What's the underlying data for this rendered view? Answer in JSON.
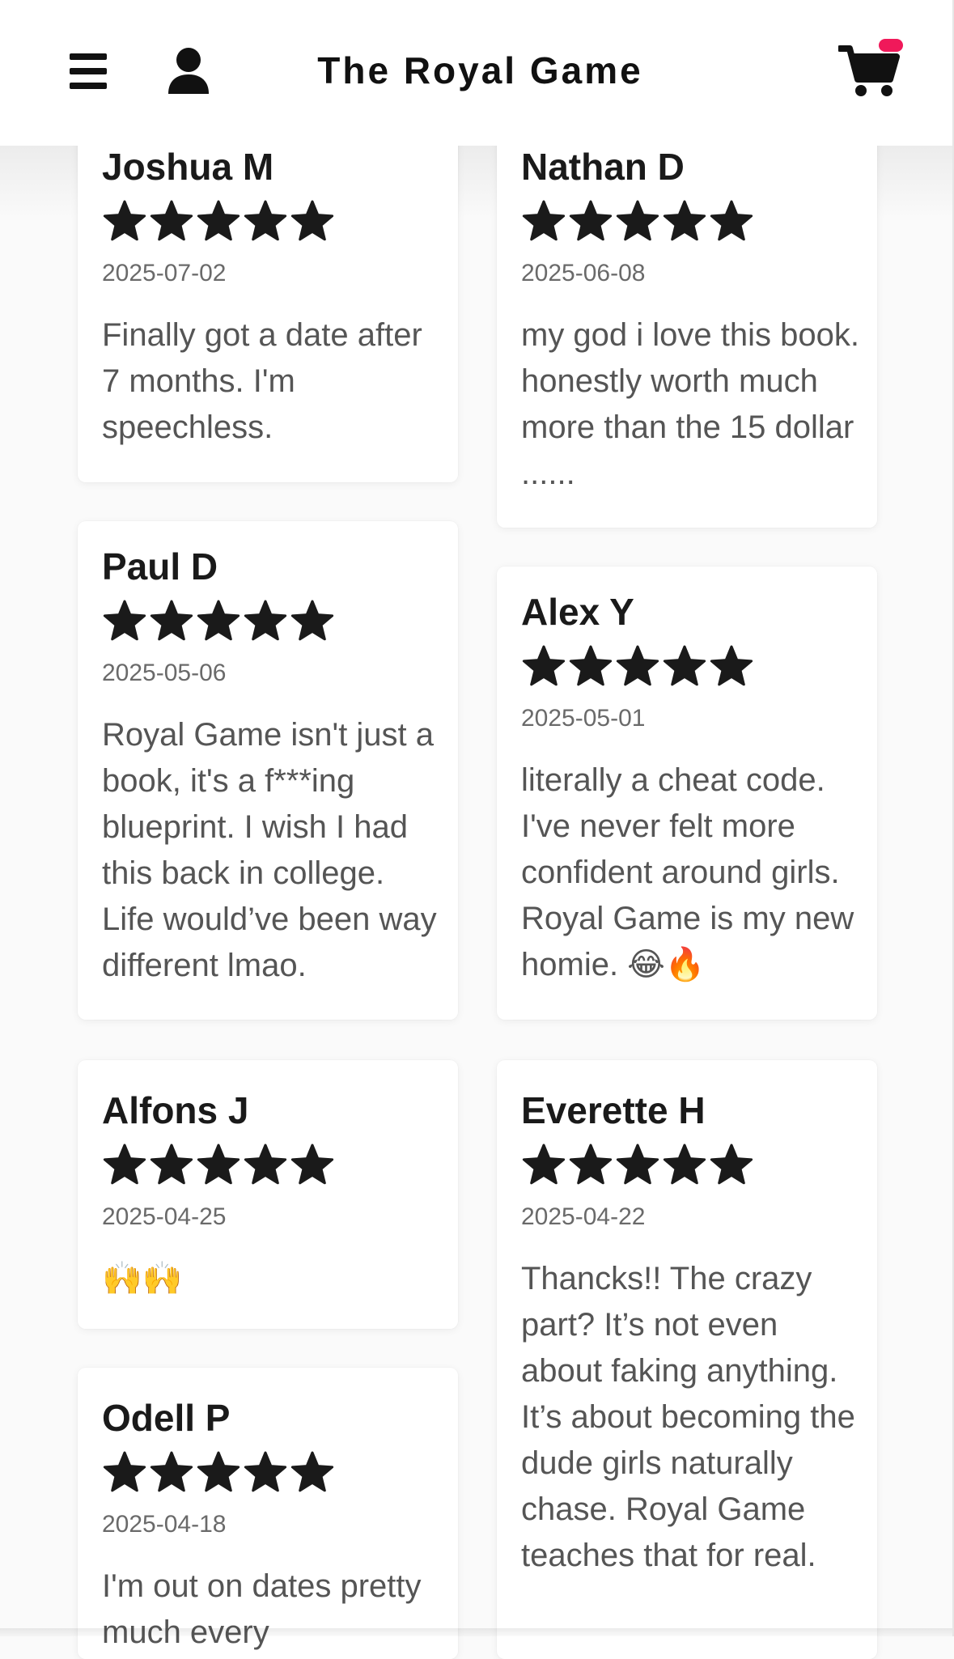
{
  "header": {
    "title": "The Royal Game",
    "menu_icon": "hamburger-menu-icon",
    "account_icon": "user-icon",
    "cart_icon": "shopping-cart-icon",
    "cart_badge_color": "#f0195a"
  },
  "reviews": [
    {
      "name": "Joshua M",
      "rating": 5,
      "date": "2025-07-02",
      "text": "Finally got a date after 7 months. I'm speechless."
    },
    {
      "name": "Nathan D",
      "rating": 5,
      "date": "2025-06-08",
      "text": "my god i love this book. honestly worth much more than the 15 dollar ......"
    },
    {
      "name": "Paul D",
      "rating": 5,
      "date": "2025-05-06",
      "text": "Royal Game isn't just a book, it's a f***ing blueprint. I wish I had this back in college. Life would’ve been way different lmao."
    },
    {
      "name": "Alex Y",
      "rating": 5,
      "date": "2025-05-01",
      "text": "literally a cheat code. I've never felt more confident around girls. Royal Game is my new homie. 😂🔥"
    },
    {
      "name": "Alfons J",
      "rating": 5,
      "date": "2025-04-25",
      "text": "🙌🙌"
    },
    {
      "name": "Everette H",
      "rating": 5,
      "date": "2025-04-22",
      "text": "Thancks!! The crazy part? It’s not even about faking anything. It’s about becoming the dude girls naturally chase. Royal Game teaches that for real."
    },
    {
      "name": "Odell P",
      "rating": 5,
      "date": "2025-04-18",
      "text": "I'm out on dates pretty much every"
    }
  ],
  "colors": {
    "star": "#1a1a1a",
    "name": "#1a1a1a",
    "date": "#6a6a6a",
    "review_text": "#555555"
  }
}
